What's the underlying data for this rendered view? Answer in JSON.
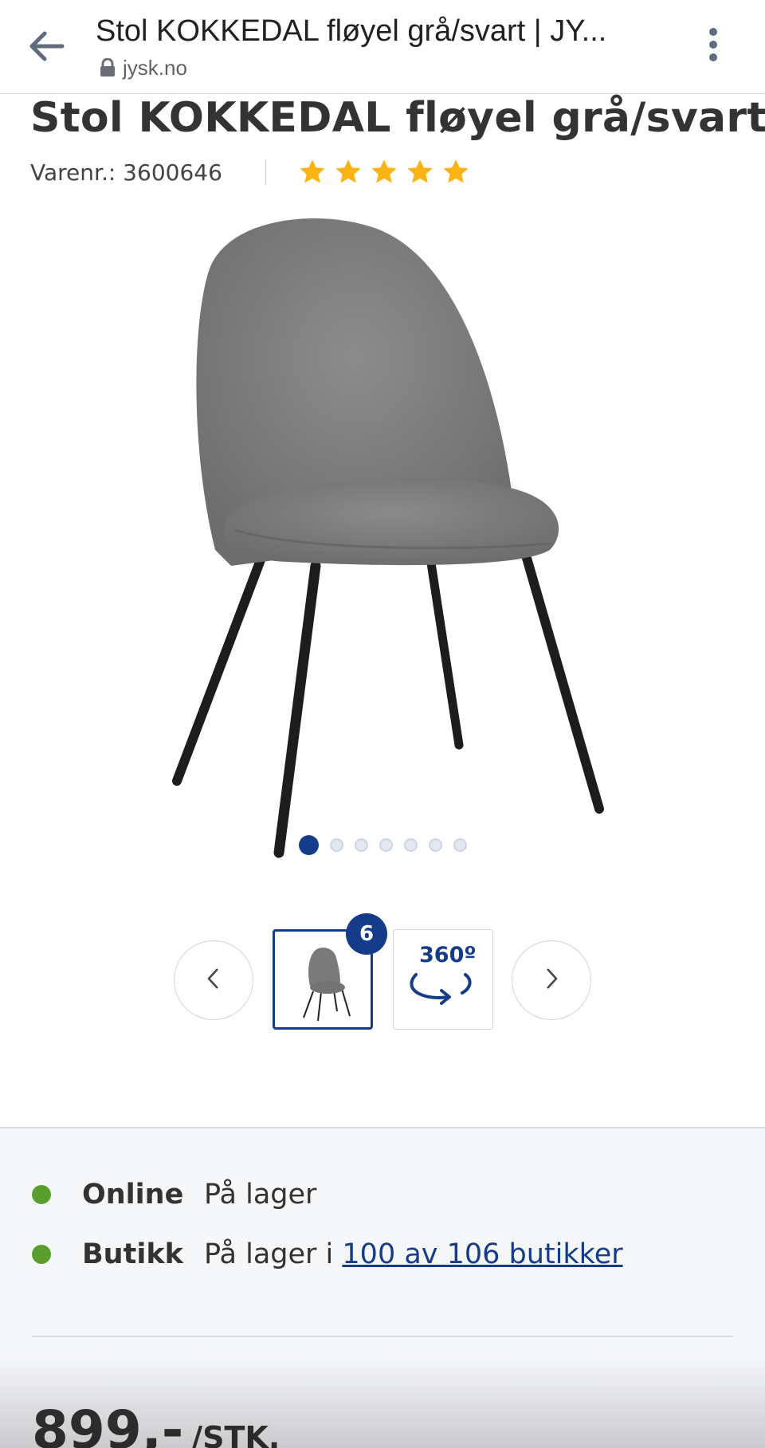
{
  "browser": {
    "tab_title": "Stol KOKKEDAL fløyel grå/svart | JY...",
    "url": "jysk.no"
  },
  "product": {
    "title": "Stol KOKKEDAL fløyel grå/svart",
    "sku_label": "Varenr.: 3600646",
    "rating": 5,
    "rating_max": 5,
    "image_count": 7,
    "active_image_index": 0
  },
  "gallery": {
    "thumbnail_count_badge": "6",
    "view_360_label": "360º"
  },
  "availability": {
    "online_label": "Online",
    "online_status": "På lager",
    "store_label": "Butikk",
    "store_status_prefix": "På lager i ",
    "store_link": "100 av 106 butikker"
  },
  "price": {
    "amount": "899,-",
    "unit": "/STK."
  },
  "colors": {
    "brand_blue": "#143c8a",
    "stock_green": "#5a9e2f",
    "star_yellow": "#fbb316"
  }
}
